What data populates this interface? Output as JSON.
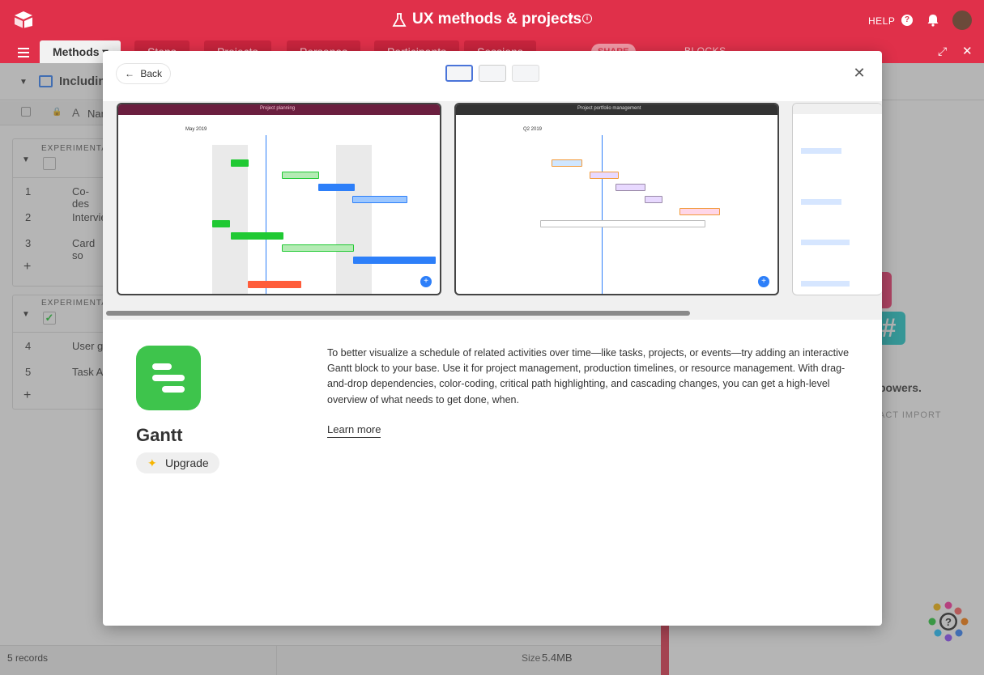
{
  "topbar": {
    "title": "UX methods & projects",
    "help_label": "HELP",
    "colors": {
      "brand": "#e0304a"
    }
  },
  "tabs": [
    {
      "label": "Methods"
    },
    {
      "label": "Steps"
    },
    {
      "label": "Projects"
    },
    {
      "label": "Personas"
    },
    {
      "label": "Participants"
    },
    {
      "label": "Sessions"
    }
  ],
  "toolbar": {
    "share_label": "SHARE",
    "blocks_label": "BLOCKS"
  },
  "view": {
    "name": "Including"
  },
  "grid": {
    "header_name": "Nam",
    "group1_label": "EXPERIMENTAL",
    "group2_label": "EXPERIMENTAL",
    "rows": [
      {
        "num": "1",
        "name": "Co-des"
      },
      {
        "num": "2",
        "name": "Intervie"
      },
      {
        "num": "3",
        "name": "Card so"
      },
      {
        "num": "4",
        "name": "User g"
      },
      {
        "num": "5",
        "name": "Task A"
      }
    ]
  },
  "right_panel": {
    "powers_text": "powers.",
    "import_text": "ACT IMPORT"
  },
  "status_bar": {
    "records": "5 records",
    "size_label": "Size",
    "size_value": "5.4MB"
  },
  "modal": {
    "back_label": "Back",
    "app_name": "Gantt",
    "upgrade_label": "Upgrade",
    "description": "To better visualize a schedule of related activities over time—like tasks, projects, or events—try adding an interactive Gantt block to your base. Use it for project management, production timelines, or resource management. With drag-and-drop dependencies, color-coding, critical path highlighting, and cascading changes, you can get a high-level overview of what needs to get done, when.",
    "learn_more_label": "Learn more",
    "screenshots": [
      {
        "title": "Project planning",
        "date_label": "May 2019"
      },
      {
        "title": "Project portfolio management",
        "date_label": "Q2 2019"
      },
      {
        "title": "",
        "date_label": ""
      }
    ]
  }
}
